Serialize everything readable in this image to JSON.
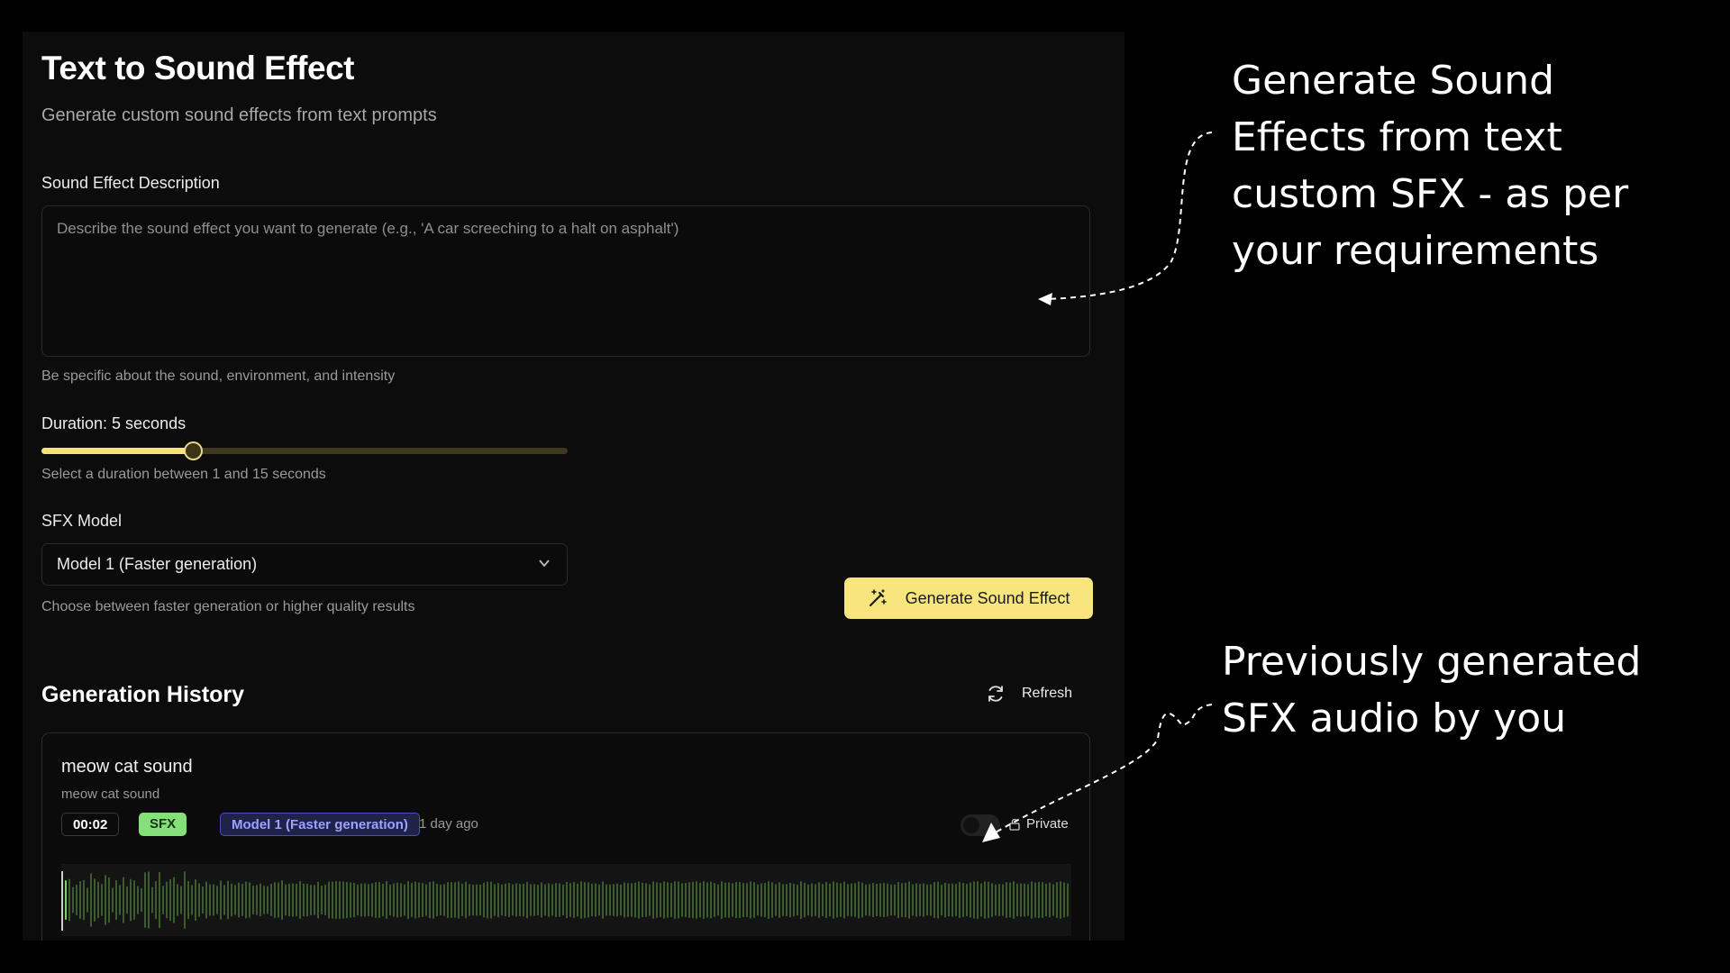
{
  "page": {
    "title": "Text to Sound Effect",
    "subtitle": "Generate custom sound effects from text prompts"
  },
  "description": {
    "label": "Sound Effect Description",
    "placeholder": "Describe the sound effect you want to generate (e.g., 'A car screeching to a halt on asphalt')",
    "help": "Be specific about the sound, environment, and intensity"
  },
  "duration": {
    "label": "Duration: 5 seconds",
    "value": 5,
    "min": 1,
    "max": 15,
    "help": "Select a duration between 1 and 15 seconds"
  },
  "model": {
    "label": "SFX Model",
    "selected": "Model 1 (Faster generation)",
    "help": "Choose between faster generation or higher quality results"
  },
  "generate_button": {
    "label": "Generate Sound Effect",
    "icon": "magic-wand-icon"
  },
  "history": {
    "title": "Generation History",
    "refresh_label": "Refresh",
    "items": [
      {
        "title": "meow cat sound",
        "prompt": "meow cat sound",
        "duration": "00:02",
        "type_badge": "SFX",
        "model_badge": "Model 1 (Faster generation)",
        "time_ago": "1 day ago",
        "visibility": "Private",
        "playback_progress": 0
      }
    ]
  },
  "annotations": {
    "top_lines": [
      "Generate Sound",
      "Effects from text",
      "custom SFX - as per",
      "your requirements"
    ],
    "bottom_lines": [
      "Previously generated",
      "SFX audio by you"
    ]
  },
  "colors": {
    "accent": "#f8e57e",
    "sfx_badge": "#86e07a",
    "model_badge": "#9ba2ff",
    "waveform": "#3d5a33"
  }
}
